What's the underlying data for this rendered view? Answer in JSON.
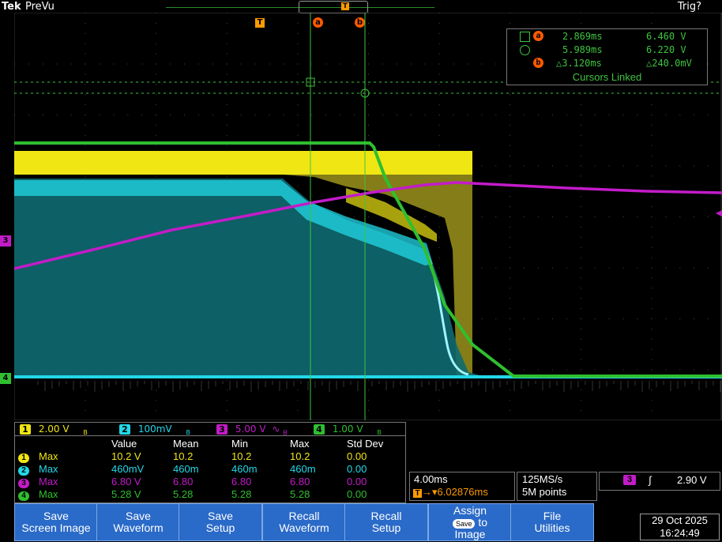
{
  "header": {
    "brand": "Tek",
    "mode": "PreVu",
    "trigger_state": "Trig?"
  },
  "markers": {
    "trigger_pos": "T",
    "cursor_a": "a",
    "cursor_b": "b",
    "ch3_ground": "3",
    "ch4_ground": "4"
  },
  "cursor_readout": {
    "a_time": "2.869ms",
    "a_volt": "6.460 V",
    "b_time": "5.989ms",
    "b_volt": "6.220 V",
    "delta_time": "△3.120ms",
    "delta_volt": "△240.0mV",
    "linked_label": "Cursors Linked"
  },
  "channels": [
    {
      "num": "1",
      "scale": "2.00 V",
      "bw": "B",
      "color": "#f0e614"
    },
    {
      "num": "2",
      "scale": "100mV",
      "bw": "B",
      "color": "#22d8e8"
    },
    {
      "num": "3",
      "scale": "5.00 V",
      "bw": "B",
      "color": "#c21cc8",
      "coupling": "∿"
    },
    {
      "num": "4",
      "scale": "1.00 V",
      "bw": "B",
      "color": "#2fbf2f"
    }
  ],
  "measurements": {
    "headers": [
      "Value",
      "Mean",
      "Min",
      "Max",
      "Std Dev"
    ],
    "rows": [
      {
        "ch": "1",
        "name": "Max",
        "value": "10.2 V",
        "mean": "10.2",
        "min": "10.2",
        "max": "10.2",
        "std": "0.00",
        "color": "#f0e614"
      },
      {
        "ch": "2",
        "name": "Max",
        "value": "460mV",
        "mean": "460m",
        "min": "460m",
        "max": "460m",
        "std": "0.00",
        "color": "#22d8e8"
      },
      {
        "ch": "3",
        "name": "Max",
        "value": "6.80 V",
        "mean": "6.80",
        "min": "6.80",
        "max": "6.80",
        "std": "0.00",
        "color": "#c21cc8"
      },
      {
        "ch": "4",
        "name": "Max",
        "value": "5.28 V",
        "mean": "5.28",
        "min": "5.28",
        "max": "5.28",
        "std": "0.00",
        "color": "#2fbf2f"
      }
    ]
  },
  "horizontal": {
    "scale": "4.00ms",
    "trigger_pos": "6.02876ms",
    "trig_badge": "T"
  },
  "acquisition": {
    "rate": "125MS/s",
    "points": "5M points"
  },
  "trigger": {
    "source": "3",
    "slope": "∫",
    "level": "2.90 V"
  },
  "buttons": [
    {
      "line1": "Save",
      "line2": "Screen Image"
    },
    {
      "line1": "Save",
      "line2": "Waveform"
    },
    {
      "line1": "Save",
      "line2": "Setup"
    },
    {
      "line1": "Recall",
      "line2": "Waveform"
    },
    {
      "line1": "Recall",
      "line2": "Setup"
    },
    {
      "line1": "Assign",
      "chip": "Save",
      "mid": "to",
      "line2": "Image"
    },
    {
      "line1": "File",
      "line2": "Utilities"
    }
  ],
  "datetime": {
    "date": "29 Oct  2025",
    "time": "16:24:49"
  }
}
